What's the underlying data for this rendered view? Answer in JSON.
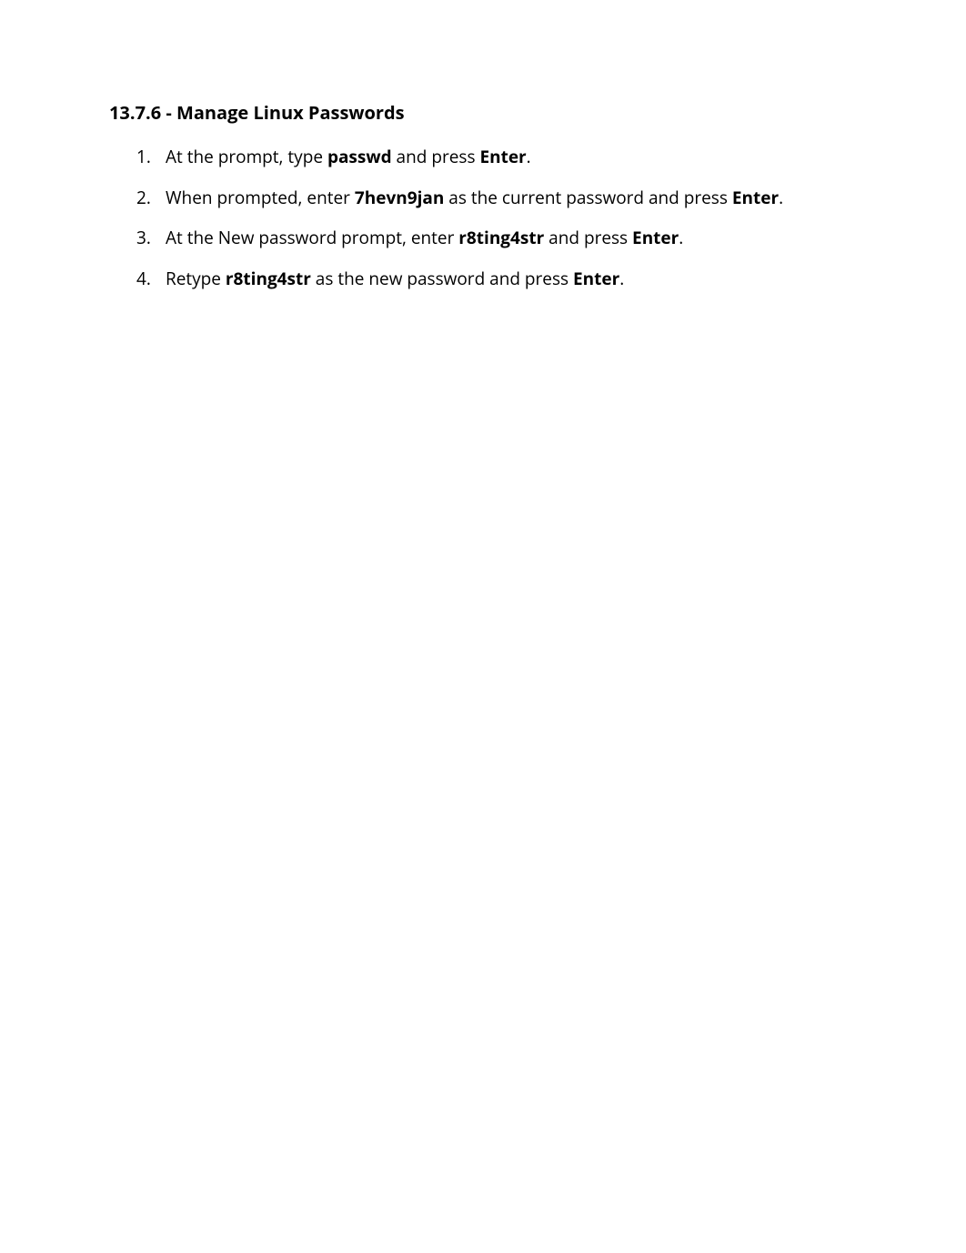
{
  "heading": "13.7.6 - Manage Linux Passwords",
  "steps": [
    {
      "num": "1.",
      "parts": [
        {
          "t": "At the prompt, type ",
          "b": false
        },
        {
          "t": "passwd",
          "b": true
        },
        {
          "t": " and press ",
          "b": false
        },
        {
          "t": "Enter",
          "b": true
        },
        {
          "t": ".",
          "b": false
        }
      ]
    },
    {
      "num": "2.",
      "parts": [
        {
          "t": "When prompted, enter ",
          "b": false
        },
        {
          "t": "7hevn9jan",
          "b": true
        },
        {
          "t": " as the current password and press ",
          "b": false
        },
        {
          "t": "Enter",
          "b": true
        },
        {
          "t": ".",
          "b": false
        }
      ]
    },
    {
      "num": "3.",
      "parts": [
        {
          "t": "At the New password prompt, enter ",
          "b": false
        },
        {
          "t": "r8ting4str",
          "b": true
        },
        {
          "t": " and press ",
          "b": false
        },
        {
          "t": "Enter",
          "b": true
        },
        {
          "t": ".",
          "b": false
        }
      ]
    },
    {
      "num": "4.",
      "parts": [
        {
          "t": "Retype ",
          "b": false
        },
        {
          "t": "r8ting4str",
          "b": true
        },
        {
          "t": " as the new password and press ",
          "b": false
        },
        {
          "t": "Enter",
          "b": true
        },
        {
          "t": ".",
          "b": false
        }
      ]
    }
  ]
}
